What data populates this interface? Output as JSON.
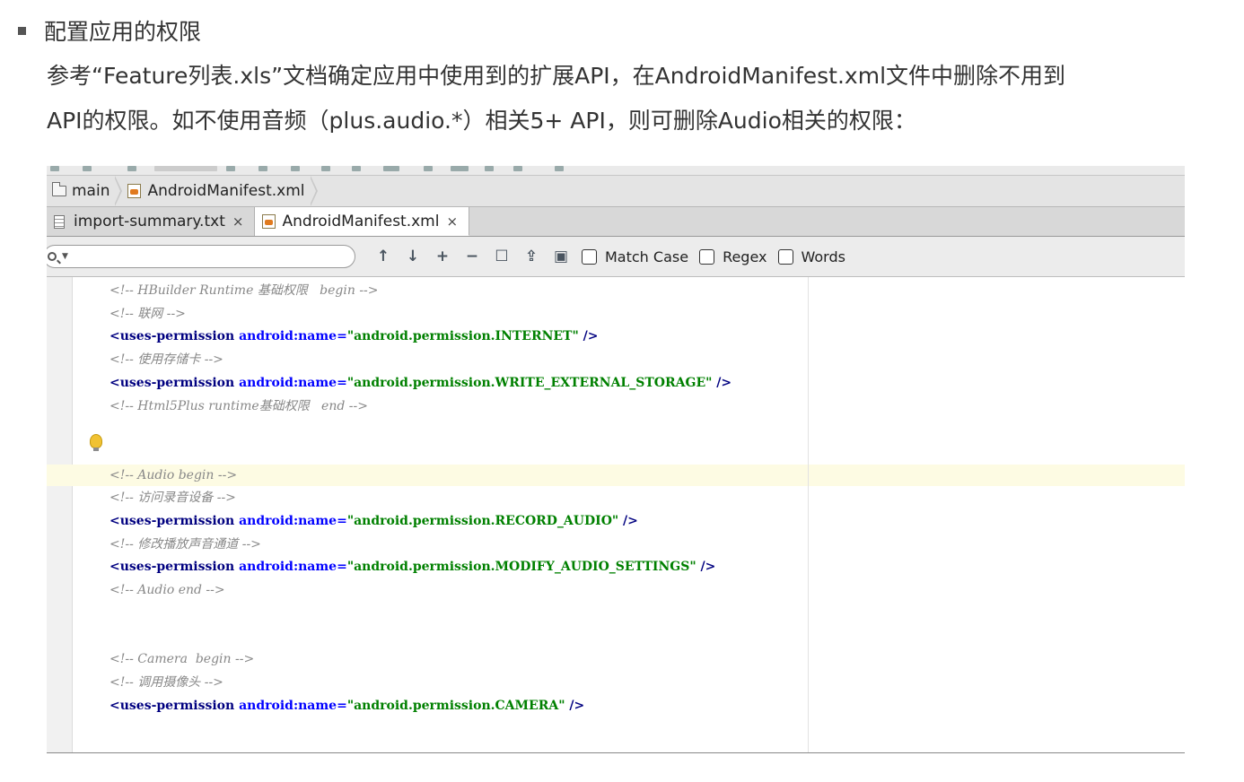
{
  "article": {
    "heading": "配置应用的权限",
    "paragraph": "参考“Feature列表.xls”文档确定应用中使用到的扩展API，在AndroidManifest.xml文件中删除不用到\nAPI的权限。如不使用音频（plus.audio.*）相关5+ API，则可删除Audio相关的权限："
  },
  "ide": {
    "breadcrumb": [
      "main",
      "AndroidManifest.xml"
    ],
    "tabs": [
      {
        "label": "import-summary.txt",
        "close": "×",
        "active": false
      },
      {
        "label": "AndroidManifest.xml",
        "close": "×",
        "active": true
      }
    ],
    "search": {
      "value": "",
      "options": [
        {
          "label": "Match Case",
          "checked": false
        },
        {
          "label": "Regex",
          "checked": false
        },
        {
          "label": "Words",
          "checked": false
        }
      ]
    },
    "code": [
      {
        "kind": "comment",
        "text": "<!-- HBuilder Runtime 基础权限   begin -->"
      },
      {
        "kind": "comment",
        "text": "<!-- 联网 -->"
      },
      {
        "kind": "perm",
        "tag": "<uses-permission",
        "attr": " android:name=",
        "value": "\"android.permission.INTERNET\"",
        "end": " />"
      },
      {
        "kind": "comment",
        "text": "<!-- 使用存储卡 -->"
      },
      {
        "kind": "perm",
        "tag": "<uses-permission",
        "attr": " android:name=",
        "value": "\"android.permission.WRITE_EXTERNAL_STORAGE\"",
        "end": " />"
      },
      {
        "kind": "comment",
        "text": "<!-- Html5Plus runtime基础权限   end -->"
      },
      {
        "kind": "blank"
      },
      {
        "kind": "blank"
      },
      {
        "kind": "comment",
        "text": "<!-- Audio begin -->"
      },
      {
        "kind": "comment",
        "text": "<!-- 访问录音设备 -->"
      },
      {
        "kind": "perm",
        "tag": "<uses-permission",
        "attr": " android:name=",
        "value": "\"android.permission.RECORD_AUDIO\"",
        "end": " />"
      },
      {
        "kind": "comment",
        "text": "<!-- 修改播放声音通道 -->"
      },
      {
        "kind": "perm",
        "tag": "<uses-permission",
        "attr": " android:name=",
        "value": "\"android.permission.MODIFY_AUDIO_SETTINGS\"",
        "end": " />"
      },
      {
        "kind": "comment",
        "text": "<!-- Audio end -->"
      },
      {
        "kind": "blank"
      },
      {
        "kind": "blank"
      },
      {
        "kind": "comment",
        "text": "<!-- Camera  begin -->"
      },
      {
        "kind": "comment",
        "text": "<!-- 调用摄像头 -->"
      },
      {
        "kind": "perm",
        "tag": "<uses-permission",
        "attr": " android:name=",
        "value": "\"android.permission.CAMERA\"",
        "end": " />"
      }
    ],
    "highlighted_line": 8,
    "colors": {
      "comment": "#888888",
      "tag": "#000080",
      "attr": "#0000ff",
      "string": "#008000",
      "highlight": "#fdfbe3"
    }
  }
}
